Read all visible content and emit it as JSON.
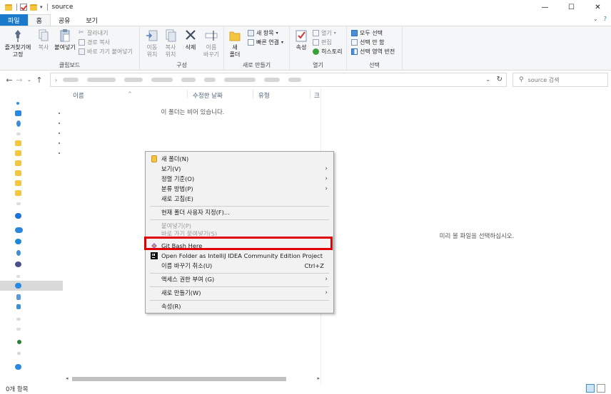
{
  "window": {
    "title": "source",
    "controls": {
      "minimize": "—",
      "maximize": "☐",
      "close": "✕"
    }
  },
  "ribbon_tabs": [
    {
      "label": "파일"
    },
    {
      "label": "홈"
    },
    {
      "label": "공유"
    },
    {
      "label": "보기"
    }
  ],
  "ribbon": {
    "clipboard": {
      "label": "클립보드",
      "pin": "즐겨찾기에 고정",
      "pin_line1": "즐겨찾기에",
      "pin_line2": "고정",
      "copy": "복사",
      "paste": "붙여넣기",
      "cut": "잘라내기",
      "copy_path": "경로 복사",
      "paste_shortcut": "바로 가기 붙여넣기"
    },
    "organize": {
      "label": "구성",
      "move_line1": "이동",
      "move_line2": "위치",
      "copy_line1": "복사",
      "copy_line2": "위치",
      "delete": "삭제",
      "rename_line1": "이름",
      "rename_line2": "바꾸기"
    },
    "new": {
      "label": "새로 만들기",
      "new_folder_line1": "새",
      "new_folder_line2": "폴더",
      "new_item": "새 항목",
      "easy_access": "빠른 연결"
    },
    "open": {
      "label": "열기",
      "properties": "속성",
      "open": "열기",
      "edit": "편집",
      "history": "히스토리"
    },
    "select": {
      "label": "선택",
      "select_all": "모두 선택",
      "select_none": "선택 안 함",
      "invert": "선택 영역 반전"
    }
  },
  "address": {
    "search_placeholder": "source 검색"
  },
  "columns": {
    "name": "이름",
    "date": "수정한 날짜",
    "type": "유형",
    "size": "크"
  },
  "filelist": {
    "empty_message": "이 폴더는 비어 있습니다."
  },
  "preview": {
    "message": "미리 볼 파일을 선택하십시오."
  },
  "status": {
    "item_count": "0개 항목"
  },
  "context_menu": {
    "items": [
      {
        "label": "새 폴더(N)"
      },
      {
        "label": "보기(V)"
      },
      {
        "label": "정렬 기준(O)"
      },
      {
        "label": "분류 방법(P)"
      },
      {
        "label": "새로 고침(E)"
      },
      {
        "label": "현재 폴더 사용자 지정(F)..."
      },
      {
        "label": "붙여넣기(P)"
      },
      {
        "label": "바로 가기 붙여넣기(S)"
      },
      {
        "label": "Git Bash Here"
      },
      {
        "label": "Open Folder as IntelliJ IDEA Community Edition Project"
      },
      {
        "label": "이름 바꾸기 취소(U)",
        "shortcut": "Ctrl+Z"
      },
      {
        "label": "액세스 권한 부여 (G)"
      },
      {
        "label": "새로 만들기(W)"
      },
      {
        "label": "속성(R)"
      }
    ]
  },
  "colors": {
    "file_tab": "#1979ca",
    "highlight_box": "#e00000",
    "menu_bg": "#f2f2f2"
  }
}
